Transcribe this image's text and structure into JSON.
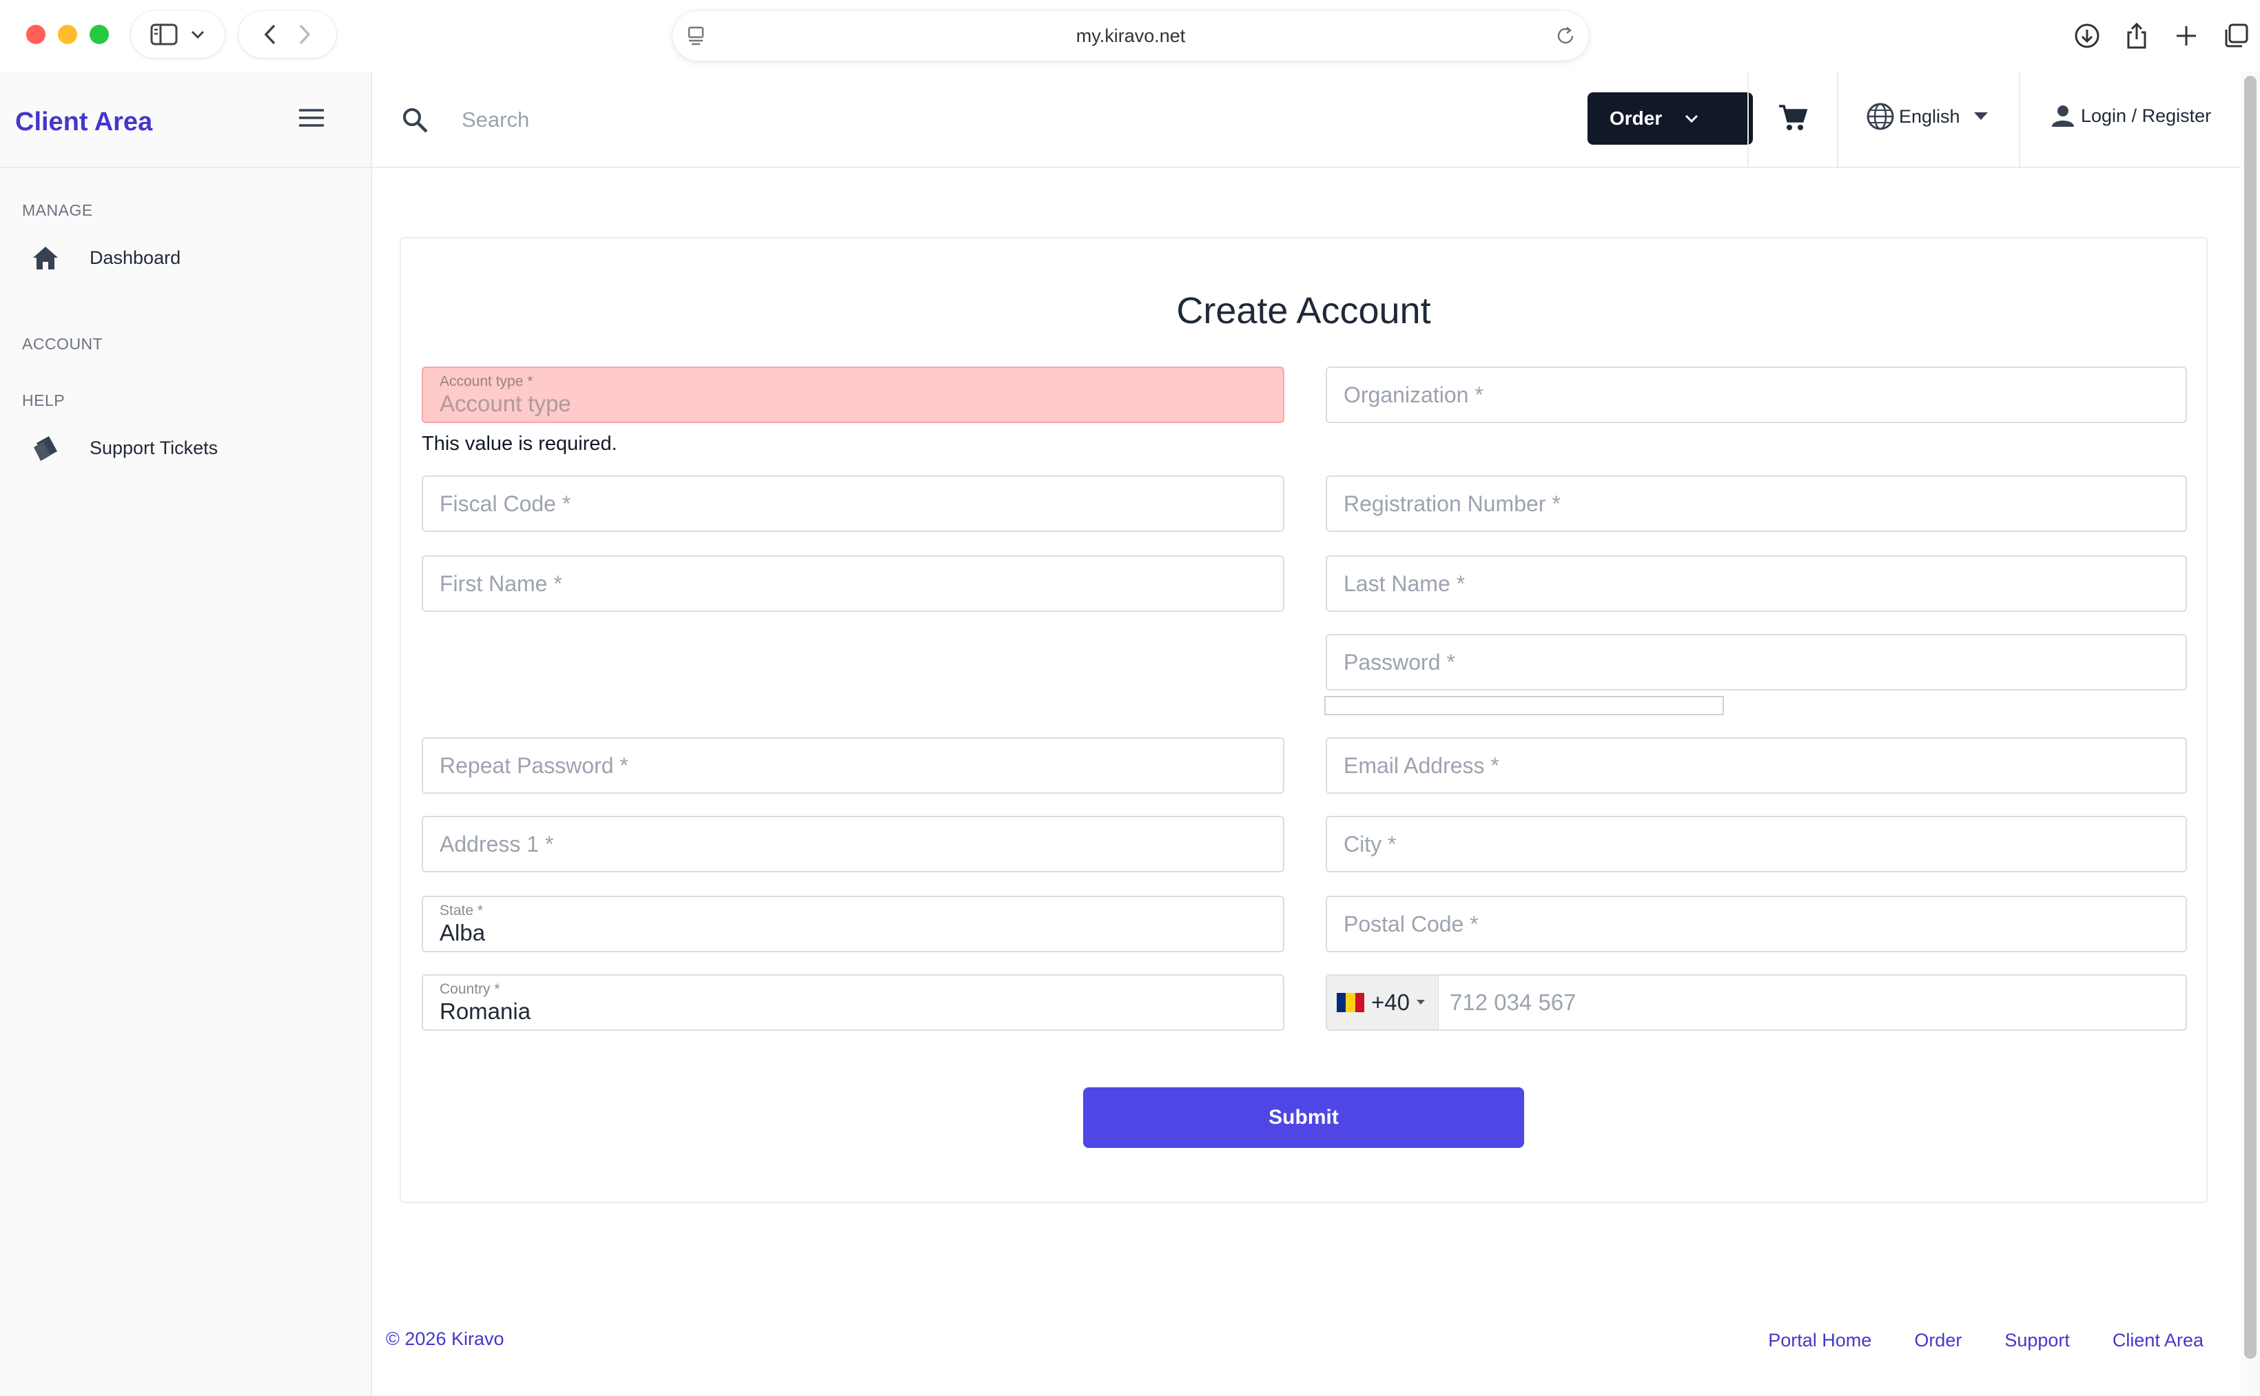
{
  "browser": {
    "url": "my.kiravo.net"
  },
  "sidebar": {
    "brand": "Client Area",
    "sections": {
      "manage": "MANAGE",
      "account": "ACCOUNT",
      "help": "HELP"
    },
    "items": [
      {
        "label": "Dashboard",
        "icon": "home-icon"
      },
      {
        "label": "Support Tickets",
        "icon": "ticket-icon"
      }
    ]
  },
  "header": {
    "search_placeholder": "Search",
    "order_label": "Order",
    "language_label": "English",
    "login_label": "Login / Register"
  },
  "form": {
    "title": "Create Account",
    "account_type": {
      "label": "Account type *",
      "placeholder": "Account type"
    },
    "error_message": "This value is required.",
    "organization": "Organization *",
    "fiscal_code": "Fiscal Code *",
    "registration_number": "Registration Number *",
    "first_name": "First Name *",
    "last_name": "Last Name *",
    "password": "Password *",
    "repeat_password": "Repeat Password *",
    "email": "Email Address *",
    "address1": "Address 1 *",
    "city": "City *",
    "state": {
      "label": "State *",
      "value": "Alba"
    },
    "postal_code": "Postal Code *",
    "country": {
      "label": "Country *",
      "value": "Romania"
    },
    "phone": {
      "code": "+40",
      "placeholder": "712 034 567",
      "flag_colors": [
        "#002b7f",
        "#fcd116",
        "#ce1126"
      ]
    },
    "submit_label": "Submit"
  },
  "footer": {
    "copyright": "© 2026 Kiravo",
    "links": [
      "Portal Home",
      "Order",
      "Support",
      "Client Area"
    ]
  },
  "colors": {
    "brand": "#4338ca",
    "primary_button": "#4f46e5",
    "order_button": "#111827",
    "error_field": "#fecaca"
  }
}
